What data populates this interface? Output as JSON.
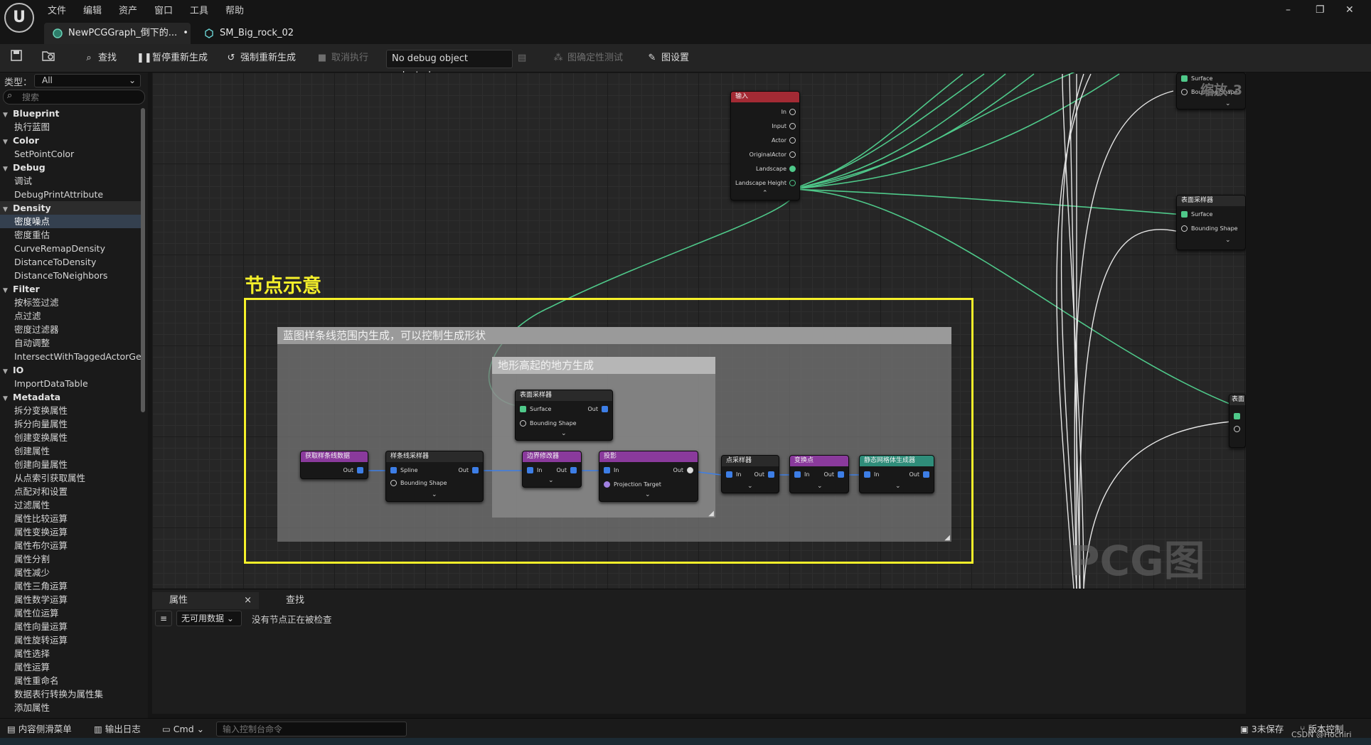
{
  "menu": [
    "文件",
    "编辑",
    "资产",
    "窗口",
    "工具",
    "帮助"
  ],
  "window_controls": {
    "minimize": "–",
    "restore": "❐",
    "close": "✕"
  },
  "tabs": [
    {
      "label": "NewPCGGraph_倒下的...",
      "modified": "•",
      "close": "×"
    },
    {
      "label": "SM_Big_rock_02"
    }
  ],
  "toolbar": {
    "find": "查找",
    "pause_regen": "暂停重新生成",
    "force_regen": "强制重新生成",
    "cancel_exec": "取消执行",
    "debug_object": "No debug object selected",
    "determinism_test": "图确定性测试",
    "graph_settings": "图设置"
  },
  "palette": {
    "type_label": "类型：",
    "type_value": "All",
    "search_placeholder": "搜索",
    "rows": [
      {
        "kind": "cat",
        "label": "Blueprint"
      },
      {
        "kind": "item",
        "label": "执行蓝图"
      },
      {
        "kind": "cat",
        "label": "Color"
      },
      {
        "kind": "item",
        "label": "SetPointColor"
      },
      {
        "kind": "cat",
        "label": "Debug"
      },
      {
        "kind": "item",
        "label": "调试"
      },
      {
        "kind": "item",
        "label": "DebugPrintAttribute"
      },
      {
        "kind": "cat",
        "label": "Density",
        "catsel": true
      },
      {
        "kind": "item",
        "label": "密度噪点",
        "selected": true
      },
      {
        "kind": "item",
        "label": "密度重估"
      },
      {
        "kind": "item",
        "label": "CurveRemapDensity"
      },
      {
        "kind": "item",
        "label": "DistanceToDensity"
      },
      {
        "kind": "item",
        "label": "DistanceToNeighbors"
      },
      {
        "kind": "cat",
        "label": "Filter"
      },
      {
        "kind": "item",
        "label": "按标签过滤"
      },
      {
        "kind": "item",
        "label": "点过滤"
      },
      {
        "kind": "item",
        "label": "密度过滤器"
      },
      {
        "kind": "item",
        "label": "自动调整"
      },
      {
        "kind": "item",
        "label": "IntersectWithTaggedActorGeo"
      },
      {
        "kind": "cat",
        "label": "IO"
      },
      {
        "kind": "item",
        "label": "ImportDataTable"
      },
      {
        "kind": "cat",
        "label": "Metadata"
      },
      {
        "kind": "item",
        "label": "拆分变换属性"
      },
      {
        "kind": "item",
        "label": "拆分向量属性"
      },
      {
        "kind": "item",
        "label": "创建变换属性"
      },
      {
        "kind": "item",
        "label": "创建属性"
      },
      {
        "kind": "item",
        "label": "创建向量属性"
      },
      {
        "kind": "item",
        "label": "从点索引获取属性"
      },
      {
        "kind": "item",
        "label": "点配对和设置"
      },
      {
        "kind": "item",
        "label": "过滤属性"
      },
      {
        "kind": "item",
        "label": "属性比较运算"
      },
      {
        "kind": "item",
        "label": "属性变换运算"
      },
      {
        "kind": "item",
        "label": "属性布尔运算"
      },
      {
        "kind": "item",
        "label": "属性分割"
      },
      {
        "kind": "item",
        "label": "属性减少"
      },
      {
        "kind": "item",
        "label": "属性三角运算"
      },
      {
        "kind": "item",
        "label": "属性数学运算"
      },
      {
        "kind": "item",
        "label": "属性位运算"
      },
      {
        "kind": "item",
        "label": "属性向量运算"
      },
      {
        "kind": "item",
        "label": "属性旋转运算"
      },
      {
        "kind": "item",
        "label": "属性选择"
      },
      {
        "kind": "item",
        "label": "属性运算"
      },
      {
        "kind": "item",
        "label": "属性重命名"
      },
      {
        "kind": "item",
        "label": "数据表行转换为属性集"
      },
      {
        "kind": "item",
        "label": "添加属性"
      }
    ]
  },
  "graph": {
    "zoom": "缩放-3",
    "watermark": "PCG图表",
    "annotation": "节点示意",
    "outer_comment": "蓝图样条线范围内生成，可以控制生成形状",
    "inner_comment": "地形高起的地方生成",
    "input_node": {
      "title": "输入",
      "pins": [
        "In",
        "Input",
        "Actor",
        "OriginalActor",
        "Landscape",
        "Landscape Height"
      ]
    },
    "right_top_node": {
      "pins": [
        "Surface",
        "Bounding Shape"
      ]
    },
    "right_mid_node": {
      "title": "表面采样器",
      "pins": [
        "Surface",
        "Bounding Shape"
      ]
    },
    "right_small_node": {
      "title": "表面"
    },
    "inner_nodes": {
      "get_spline": {
        "title": "获取样条线数据",
        "out": "Out"
      },
      "spline_sampler": {
        "title": "样条线采样器",
        "pins": [
          "Spline",
          "Bounding Shape"
        ],
        "out": "Out"
      },
      "surface_sampler": {
        "title": "表面采样器",
        "pins": [
          "Surface",
          "Bounding Shape"
        ],
        "out": "Out"
      },
      "bounds_modifier": {
        "title": "边界修改器",
        "in": "In",
        "out": "Out"
      },
      "projection": {
        "title": "投影",
        "pins": [
          "In",
          "Projection Target"
        ],
        "out": "Out"
      },
      "point_sampler": {
        "title": "点采样器",
        "in": "In",
        "out": "Out"
      },
      "transform_points": {
        "title": "变换点",
        "in": "In",
        "out": "Out"
      },
      "static_mesh_spawner": {
        "title": "静态网格体生成器",
        "in": "In",
        "out": "Out"
      }
    }
  },
  "details": {
    "tab_properties": "属性",
    "tab_find": "查找",
    "close": "×",
    "no_data": "无可用数据",
    "empty_msg": "没有节点正在被检查"
  },
  "statusbar": {
    "content_drawer": "内容侧滑菜单",
    "output_log": "输出日志",
    "cmd": "Cmd",
    "cmd_placeholder": "输入控制台命令",
    "unsaved": "3未保存",
    "source_control": "版本控制",
    "watermark": "CSDN @Hochiri_"
  },
  "colors": {
    "accent_green": "#4fc98a",
    "comment_yellow": "#f5f02a",
    "pin_blue": "#3d7ee6",
    "header_purple": "#8a3a9c",
    "header_teal": "#2f8d7a",
    "header_red": "#a32a34"
  }
}
